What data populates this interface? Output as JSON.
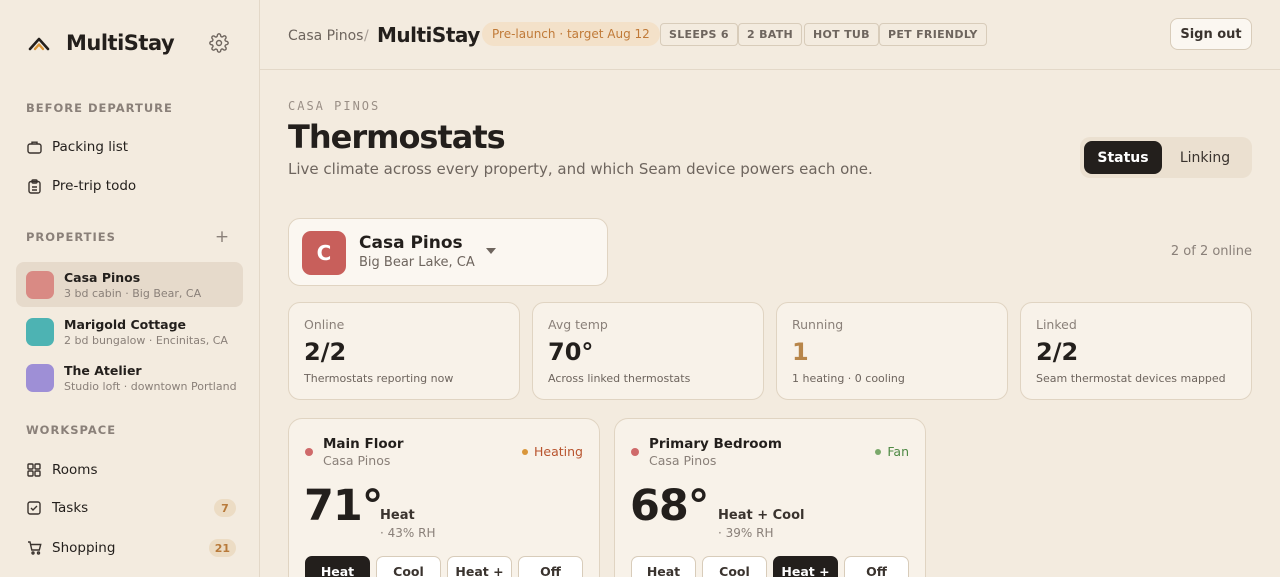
{
  "app": {
    "name": "MultiStay"
  },
  "sidebar": {
    "before_departure_label": "BEFORE DEPARTURE",
    "before_departure": [
      {
        "label": "Packing list",
        "icon": "suitcase-icon"
      },
      {
        "label": "Pre-trip todo",
        "icon": "clipboard-icon"
      }
    ],
    "properties_label": "PROPERTIES",
    "properties": [
      {
        "name": "Casa Pinos",
        "sub": "3 bd cabin · Big Bear, CA",
        "color": "#d98a84",
        "active": true
      },
      {
        "name": "Marigold Cottage",
        "sub": "2 bd bungalow · Encinitas, CA",
        "color": "#4db3b3",
        "active": false
      },
      {
        "name": "The Atelier",
        "sub": "Studio loft · downtown Portland",
        "color": "#9e8fd6",
        "active": false
      }
    ],
    "workspace_label": "WORKSPACE",
    "workspace": [
      {
        "label": "Rooms",
        "icon": "grid-icon",
        "badge": ""
      },
      {
        "label": "Tasks",
        "icon": "checkbox-icon",
        "badge": "7"
      },
      {
        "label": "Shopping",
        "icon": "cart-icon",
        "badge": "21"
      }
    ]
  },
  "header": {
    "breadcrumb_parent": "Casa Pinos",
    "breadcrumb_sep": "/",
    "breadcrumb_current": "MultiStay",
    "prelaunch": "Pre-launch · target Aug 12",
    "tags": [
      "SLEEPS 6",
      "2 BATH",
      "HOT TUB",
      "PET FRIENDLY"
    ],
    "sign_out": "Sign out"
  },
  "page": {
    "eyebrow": "CASA PINOS",
    "title": "Thermostats",
    "subtitle": "Live climate across every property, and which Seam device powers each one.",
    "tabs": [
      {
        "label": "Status",
        "active": true
      },
      {
        "label": "Linking",
        "active": false
      }
    ]
  },
  "property_select": {
    "initial": "C",
    "name": "Casa Pinos",
    "location": "Big Bear Lake, CA",
    "online": "2 of 2 online"
  },
  "stats": [
    {
      "label": "Online",
      "value": "2/2",
      "note": "Thermostats reporting now",
      "color": "#231f1c"
    },
    {
      "label": "Avg temp",
      "value": "70°",
      "note": "Across linked thermostats",
      "color": "#231f1c"
    },
    {
      "label": "Running",
      "value": "1",
      "note": "1 heating · 0 cooling",
      "color": "#b8864a"
    },
    {
      "label": "Linked",
      "value": "2/2",
      "note": "Seam thermostat devices mapped",
      "color": "#231f1c"
    }
  ],
  "thermostats": [
    {
      "name": "Main Floor",
      "property": "Casa Pinos",
      "status": "Heating",
      "status_color": "#d9963a",
      "status_text_color": "#b8542e",
      "temp": "71°",
      "mode": "Heat",
      "humidity": "· 43% RH",
      "modes": [
        "Heat",
        "Cool",
        "Heat +",
        "Off"
      ],
      "selected_mode": "Heat"
    },
    {
      "name": "Primary Bedroom",
      "property": "Casa Pinos",
      "status": "Fan",
      "status_color": "#7aa86a",
      "status_text_color": "#4f8a45",
      "temp": "68°",
      "mode": "Heat + Cool",
      "humidity": "· 39% RH",
      "modes": [
        "Heat",
        "Cool",
        "Heat +",
        "Off"
      ],
      "selected_mode": "Heat +"
    }
  ]
}
